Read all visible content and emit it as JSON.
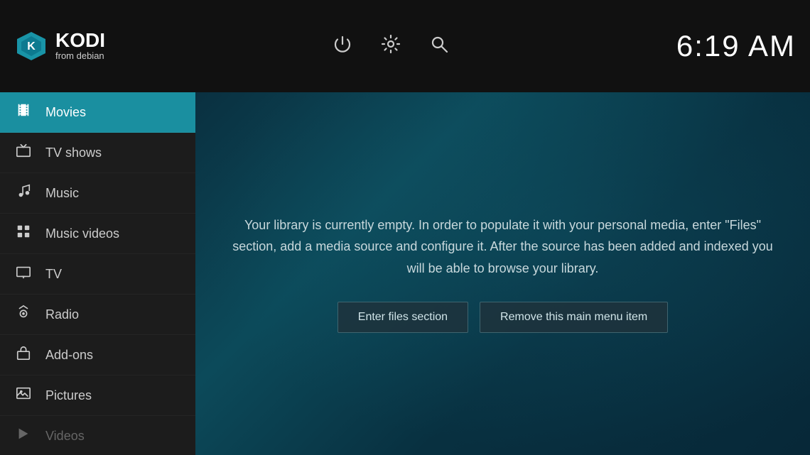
{
  "topbar": {
    "brand": "KODI",
    "subtitle": "from debian",
    "time": "6:19 AM"
  },
  "nav": {
    "items": [
      {
        "id": "movies",
        "label": "Movies",
        "icon": "movies",
        "active": true,
        "dimmed": false
      },
      {
        "id": "tvshows",
        "label": "TV shows",
        "icon": "tv",
        "active": false,
        "dimmed": false
      },
      {
        "id": "music",
        "label": "Music",
        "icon": "music",
        "active": false,
        "dimmed": false
      },
      {
        "id": "musicvideos",
        "label": "Music videos",
        "icon": "grid",
        "active": false,
        "dimmed": false
      },
      {
        "id": "tv",
        "label": "TV",
        "icon": "monitor",
        "active": false,
        "dimmed": false
      },
      {
        "id": "radio",
        "label": "Radio",
        "icon": "radio",
        "active": false,
        "dimmed": false
      },
      {
        "id": "addons",
        "label": "Add-ons",
        "icon": "box",
        "active": false,
        "dimmed": false
      },
      {
        "id": "pictures",
        "label": "Pictures",
        "icon": "picture",
        "active": false,
        "dimmed": false
      },
      {
        "id": "videos",
        "label": "Videos",
        "icon": "video",
        "active": false,
        "dimmed": true
      }
    ]
  },
  "content": {
    "library_message": "Your library is currently empty. In order to populate it with your personal media, enter \"Files\" section, add a media source and configure it. After the source has been added and indexed you will be able to browse your library.",
    "btn_files": "Enter files section",
    "btn_remove": "Remove this main menu item"
  }
}
